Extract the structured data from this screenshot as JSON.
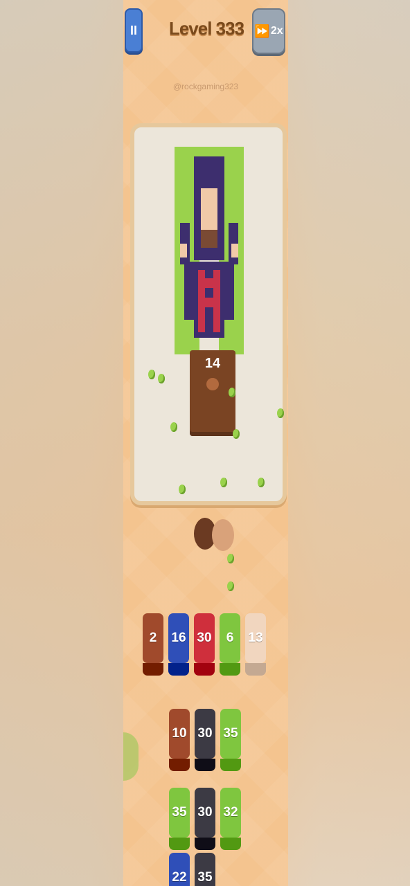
{
  "header": {
    "pause_label": "II",
    "level_title": "Level 333",
    "skip_label": "2x",
    "username": "@rockgaming323"
  },
  "board": {
    "box_count": "14"
  },
  "tray": {
    "slots": [
      {
        "value": "2",
        "color": "#a04a2c"
      },
      {
        "value": "16",
        "color": "#2f4fb8"
      },
      {
        "value": "30",
        "color": "#cf2f3c"
      },
      {
        "value": "6",
        "color": "#7fc63f"
      },
      {
        "value": "13",
        "color": "#f1d6bf"
      }
    ]
  },
  "queue": {
    "rows": [
      [
        {
          "value": "10",
          "color": "#a04a2c"
        },
        {
          "value": "30",
          "color": "#3c3a44"
        },
        {
          "value": "35",
          "color": "#7fc63f"
        }
      ],
      [
        {
          "value": "35",
          "color": "#7fc63f"
        },
        {
          "value": "30",
          "color": "#3c3a44"
        },
        {
          "value": "32",
          "color": "#7fc63f"
        }
      ],
      [
        {
          "value": "22",
          "color": "#2f4fb8"
        },
        {
          "value": "35",
          "color": "#3c3a44"
        }
      ]
    ]
  },
  "colors": {
    "background": "#f4c48f",
    "board": "#ece6da",
    "board_frame": "#e6c89c",
    "beads_green": "#9ad24c",
    "beads_navy": "#3d2e6e",
    "beads_red": "#c9334a",
    "beads_skin": "#f1c9a8"
  }
}
